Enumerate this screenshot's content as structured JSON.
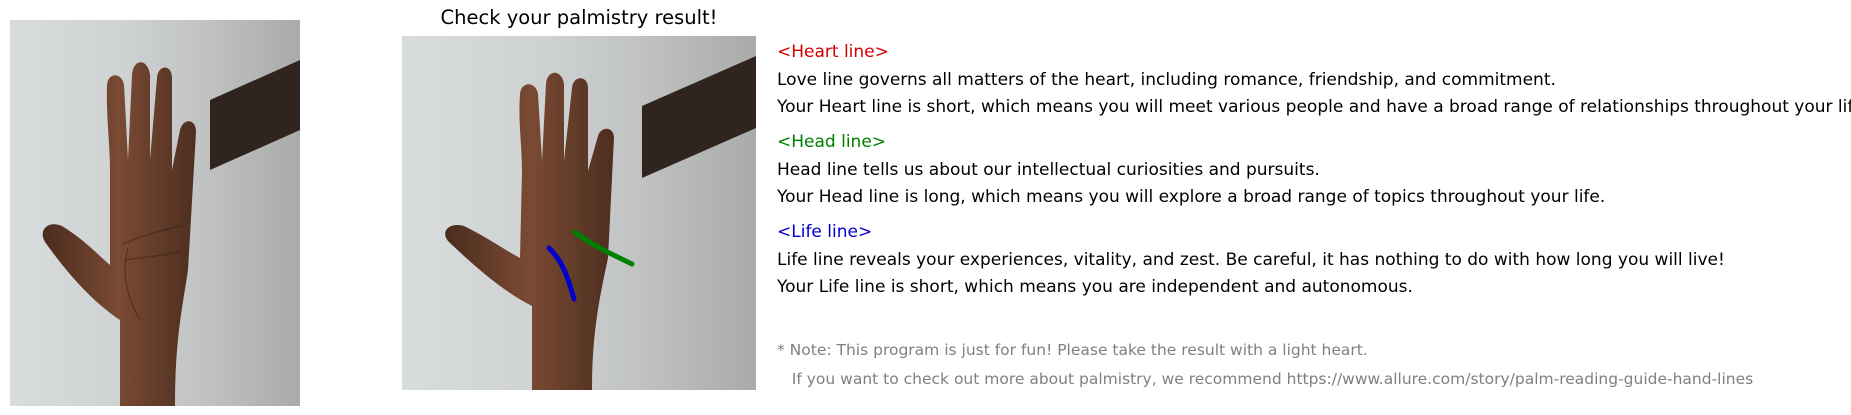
{
  "title": "Check your palmistry result!",
  "images": {
    "left": {
      "label": "original-hand-photo"
    },
    "right": {
      "label": "annotated-hand-photo"
    }
  },
  "colors": {
    "heart": "#d30000",
    "head": "#008000",
    "life": "#0000cc",
    "note": "#808080"
  },
  "results": {
    "heart": {
      "heading": "<Heart line>",
      "description": "Love line governs all matters of the heart, including romance, friendship, and commitment.",
      "result": "Your Heart line is short, which means you will meet various people and have a broad range of relationships throughout your life."
    },
    "head": {
      "heading": "<Head line>",
      "description": "Head line tells us about our intellectual curiosities and pursuits.",
      "result": "Your Head line is long, which means you will explore a broad range of topics throughout your life."
    },
    "life": {
      "heading": "<Life line>",
      "description": "Life line reveals your experiences, vitality, and zest. Be careful, it has nothing to do with how long you will live!",
      "result": "Your Life line is short, which means you are independent and autonomous."
    }
  },
  "notes": {
    "fun": "* Note: This program is just for fun! Please take the result with a light heart.",
    "link": "   If you want to check out more about palmistry, we recommend https://www.allure.com/story/palm-reading-guide-hand-lines"
  }
}
